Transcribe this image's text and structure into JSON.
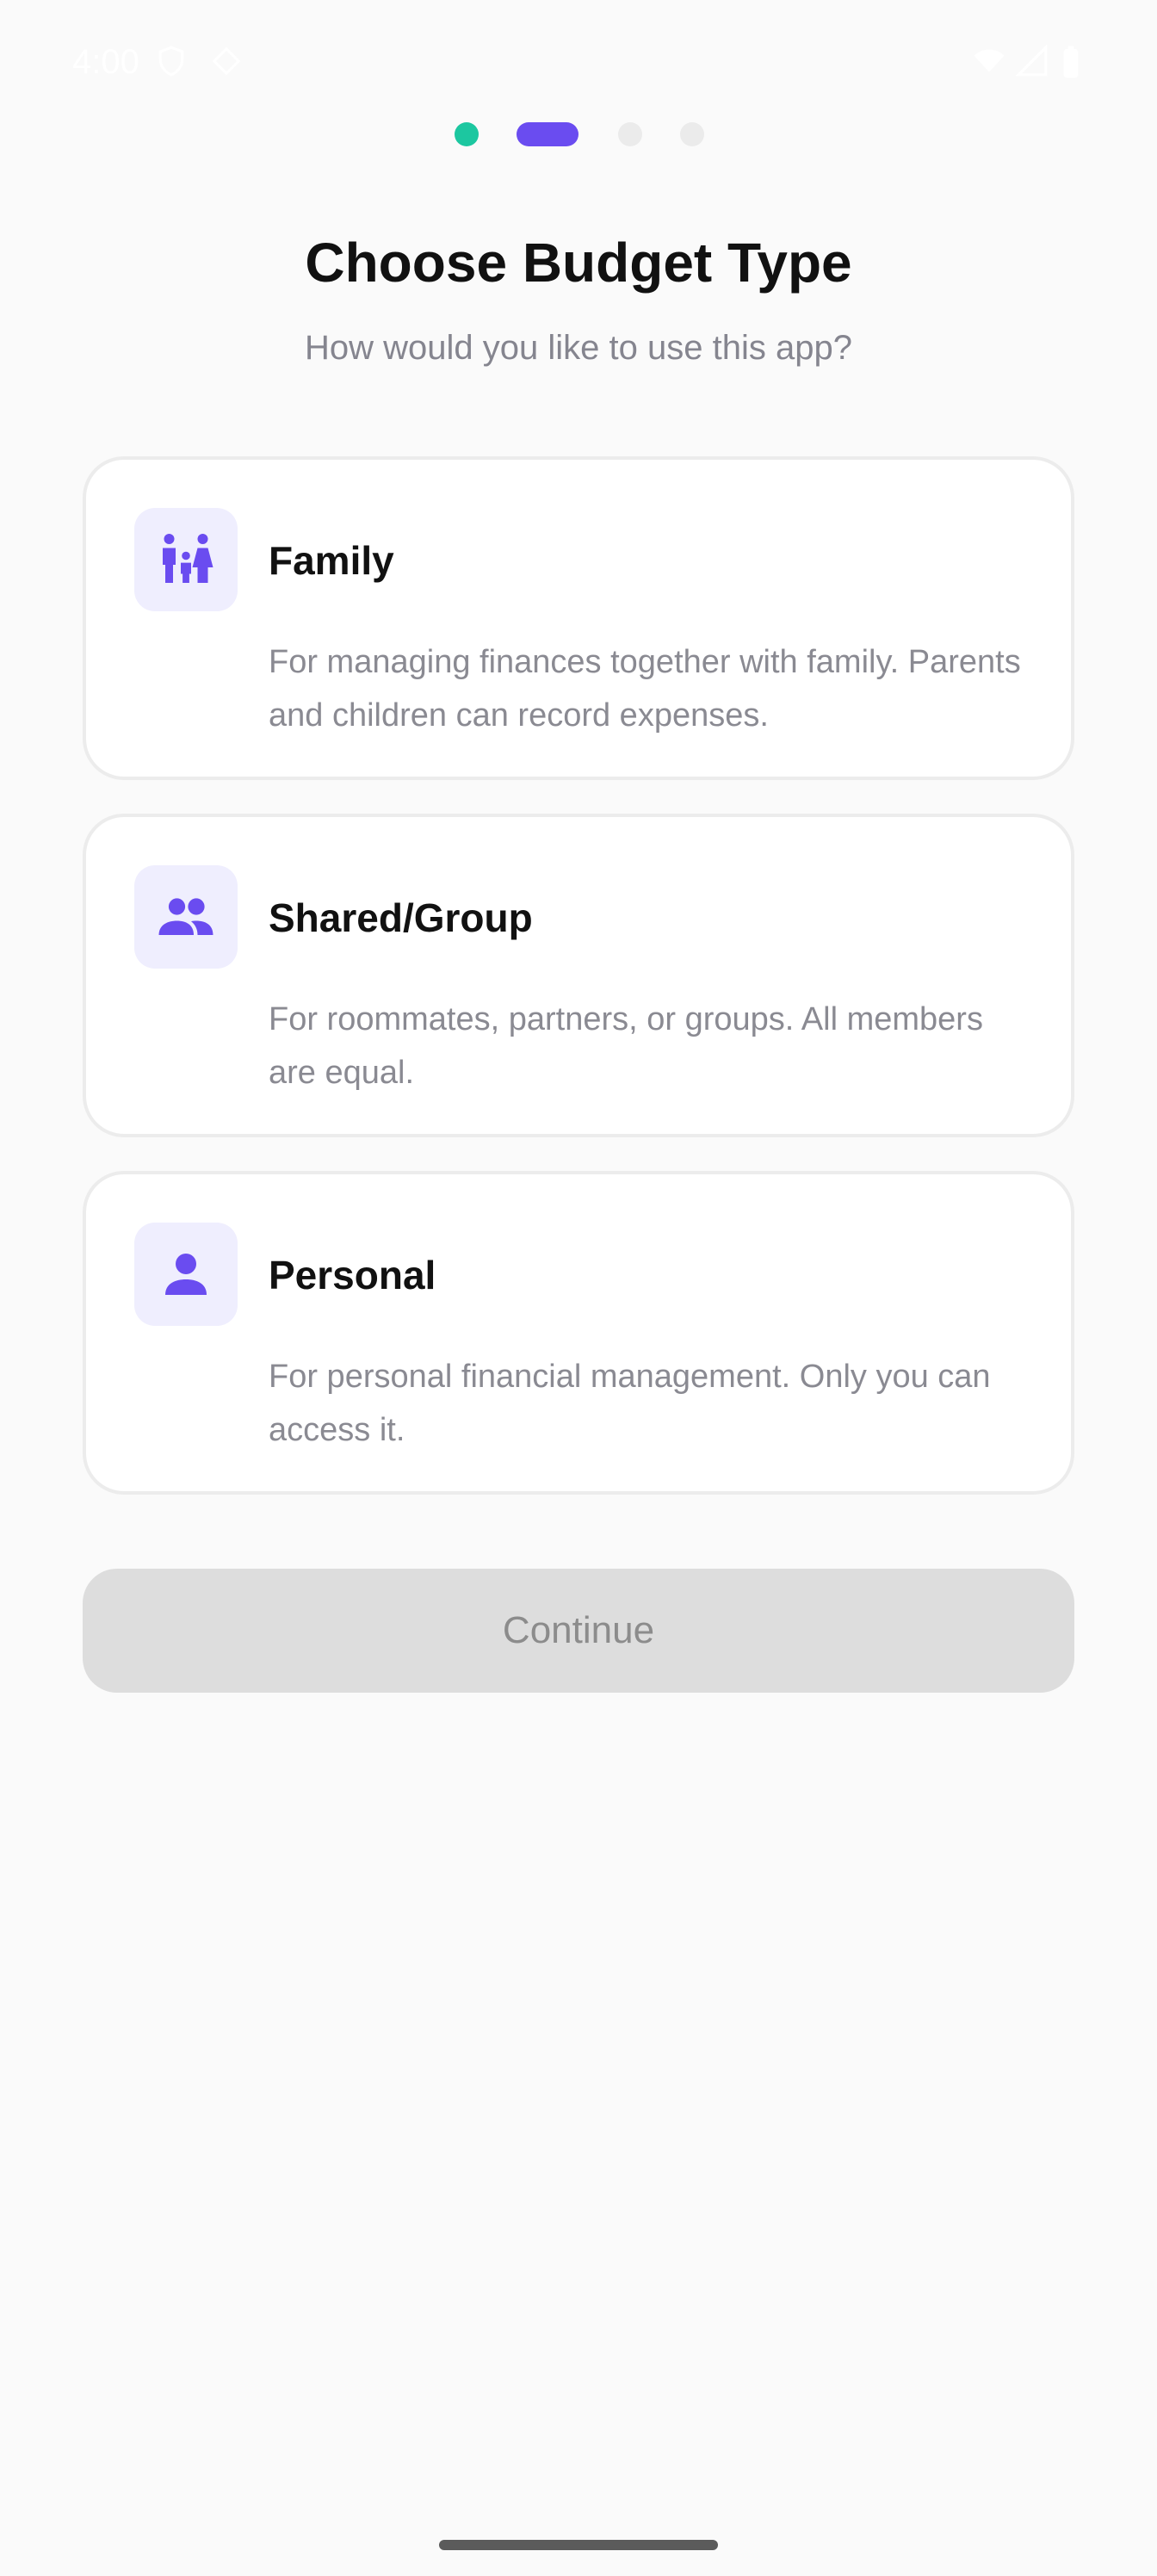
{
  "status_bar": {
    "time": "4:00"
  },
  "stepper": {
    "total_steps": 4,
    "current_step": 2,
    "colors": {
      "completed": "#1cc7a0",
      "active": "#6a4cf0",
      "upcoming": "#ebebeb"
    }
  },
  "header": {
    "title": "Choose Budget Type",
    "subtitle": "How would you like to use this app?"
  },
  "options": [
    {
      "icon": "family-icon",
      "title": "Family",
      "description": "For managing finances together with family. Parents and children can record expenses."
    },
    {
      "icon": "group-icon",
      "title": "Shared/Group",
      "description": "For roommates, partners, or groups. All members are equal."
    },
    {
      "icon": "person-icon",
      "title": "Personal",
      "description": "For personal financial management. Only you can access it."
    }
  ],
  "continue_button": {
    "label": "Continue",
    "enabled": false
  },
  "colors": {
    "accent": "#6a4cf0",
    "icon_background": "#efeefe",
    "background": "#fafafa"
  }
}
